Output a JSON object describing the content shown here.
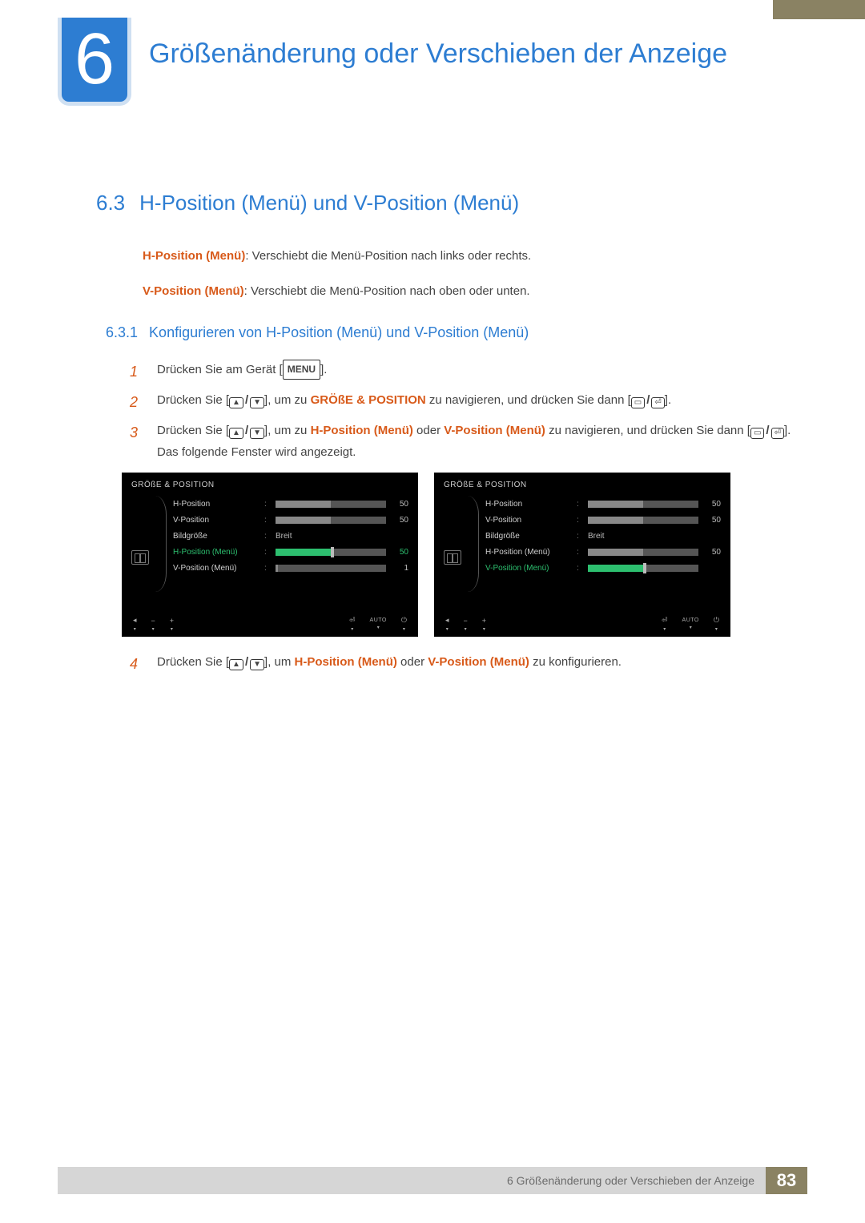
{
  "chapter": {
    "number": "6",
    "title": "Größenänderung oder Verschieben der Anzeige"
  },
  "section": {
    "number": "6.3",
    "title": "H-Position (Menü) und V-Position (Menü)"
  },
  "intro": {
    "h_label": "H-Position (Menü)",
    "h_text": ": Verschiebt die Menü-Position nach links oder rechts.",
    "v_label": "V-Position (Menü)",
    "v_text": ": Verschiebt die Menü-Position nach oben oder unten."
  },
  "subsection": {
    "number": "6.3.1",
    "title": "Konfigurieren von H-Position (Menü) und V-Position (Menü)"
  },
  "steps": {
    "s1": {
      "n": "1",
      "a": "Drücken Sie am Gerät [",
      "menu": "MENU",
      "b": "]."
    },
    "s2": {
      "n": "2",
      "a": "Drücken Sie [",
      "b": "], um zu ",
      "target": "GRÖßE & POSITION",
      "c": " zu navigieren, und drücken Sie dann [",
      "d": "]."
    },
    "s3": {
      "n": "3",
      "a": "Drücken Sie [",
      "b": "], um zu ",
      "t1": "H-Position (Menü)",
      "mid": " oder ",
      "t2": "V-Position (Menü)",
      "c": " zu navigieren, und drücken Sie dann [",
      "d": "]. Das folgende Fenster wird angezeigt."
    },
    "s4": {
      "n": "4",
      "a": "Drücken Sie [",
      "b": "], um ",
      "t1": "H-Position (Menü)",
      "mid": " oder ",
      "t2": "V-Position (Menü)",
      "c": " zu konfigurieren."
    }
  },
  "osd": {
    "title": "GRÖßE & POSITION",
    "items": {
      "hpos": {
        "label": "H-Position",
        "value": "50"
      },
      "vpos": {
        "label": "V-Position",
        "value": "50"
      },
      "size": {
        "label": "Bildgröße",
        "value": "Breit"
      },
      "hmenu": {
        "label": "H-Position (Menü)",
        "value": "50"
      },
      "vmenu": {
        "label": "V-Position (Menü)",
        "value": "1"
      }
    },
    "auto": "AUTO"
  },
  "footer": {
    "text": "6 Größenänderung oder Verschieben der Anzeige",
    "page": "83"
  }
}
